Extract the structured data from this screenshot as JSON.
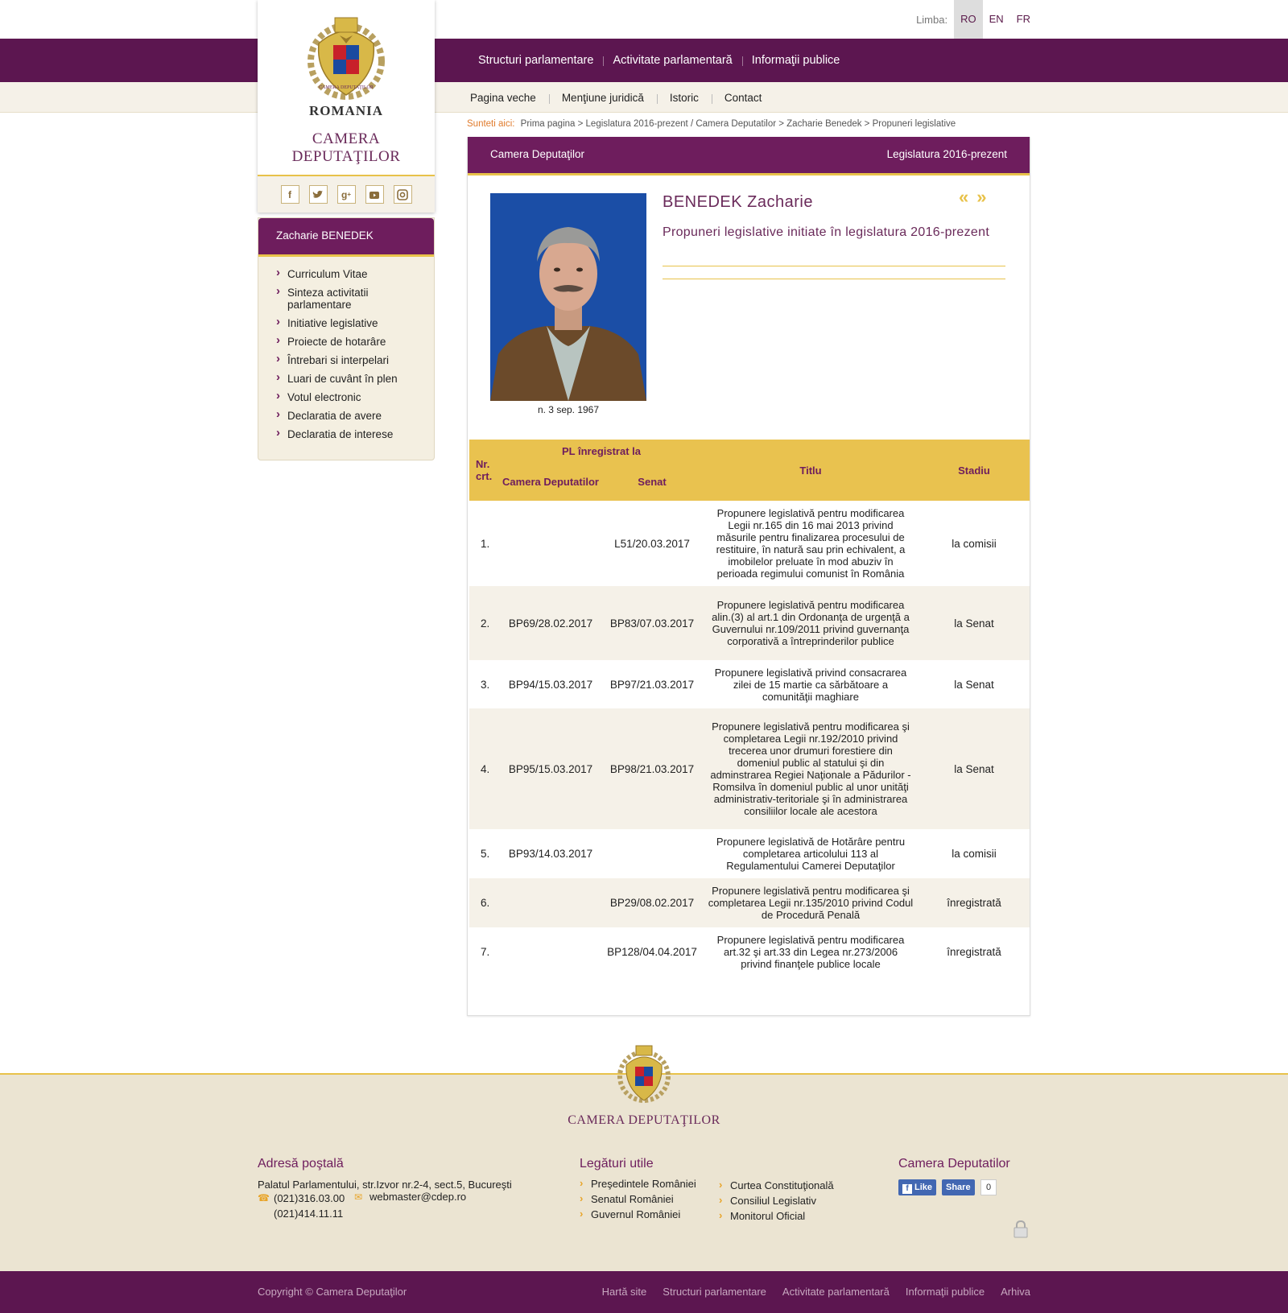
{
  "lang": {
    "label": "Limba:",
    "options": [
      "RO",
      "EN",
      "FR"
    ],
    "active": "RO"
  },
  "logo": {
    "country": "ROMANIA",
    "institution_line1": "CAMERA",
    "institution_line2": "DEPUTAŢILOR"
  },
  "social": [
    "facebook-icon",
    "twitter-icon",
    "google-plus-icon",
    "youtube-icon",
    "instagram-icon"
  ],
  "main_nav": [
    "Structuri parlamentare",
    "Activitate parlamentară",
    "Informaţii publice"
  ],
  "sub_nav": [
    "Pagina veche",
    "Menţiune juridică",
    "Istoric",
    "Contact"
  ],
  "breadcrumb": {
    "label": "Sunteti aici:",
    "path": "Prima pagina > Legislatura 2016-prezent / Camera Deputatilor > Zacharie Benedek > Propuneri legislative"
  },
  "sidebar": {
    "title": "Zacharie BENEDEK",
    "items": [
      "Curriculum Vitae",
      "Sinteza activitatii parlamentare",
      "Initiative legislative",
      "Proiecte de hotarâre",
      "Întrebari si interpelari",
      "Luari de cuvânt în plen",
      "Votul electronic",
      "Declaratia de avere",
      "Declaratia de interese"
    ]
  },
  "panel": {
    "left_title": "Camera Deputaţilor",
    "right_title": "Legislatura 2016-prezent",
    "name": "BENEDEK Zacharie",
    "birth": "n. 3 sep. 1967",
    "subtitle": "Propuneri legislative initiate în legislatura 2016-prezent",
    "prev_arrow": "«",
    "next_arrow": "»"
  },
  "table": {
    "headers": {
      "nr": "Nr. crt.",
      "pl": "PL înregistrat la",
      "cd": "Camera Deputatilor",
      "senat": "Senat",
      "titlu": "Titlu",
      "stadiu": "Stadiu"
    },
    "rows": [
      {
        "nr": "1.",
        "cd": "",
        "senat": "L51/20.03.2017",
        "titlu": "Propunere legislativă pentru modificarea Legii nr.165 din 16 mai 2013 privind măsurile pentru finalizarea procesului de restituire, în natură sau prin echivalent, a imobilelor preluate în mod abuziv în perioada regimului comunist în România",
        "stadiu": "la comisii"
      },
      {
        "nr": "2.",
        "cd": "BP69/28.02.2017",
        "senat": "BP83/07.03.2017",
        "titlu": "Propunere legislativă pentru modificarea alin.(3) al art.1 din Ordonanţa de urgenţă a Guvernului nr.109/2011 privind guvernanţa corporativă a întreprinderilor publice",
        "stadiu": "la Senat"
      },
      {
        "nr": "3.",
        "cd": "BP94/15.03.2017",
        "senat": "BP97/21.03.2017",
        "titlu": "Propunere legislativă privind consacrarea zilei de 15 martie ca sărbătoare a comunităţii maghiare",
        "stadiu": "la Senat"
      },
      {
        "nr": "4.",
        "cd": "BP95/15.03.2017",
        "senat": "BP98/21.03.2017",
        "titlu": "Propunere legislativă pentru modificarea şi completarea Legii nr.192/2010 privind trecerea unor drumuri forestiere din domeniul public al statului şi din adminstrarea Regiei Naţionale a Pădurilor - Romsilva în domeniul public al unor unităţi administrativ-teritoriale şi în administrarea consiliilor locale ale acestora",
        "stadiu": "la Senat"
      },
      {
        "nr": "5.",
        "cd": "BP93/14.03.2017",
        "senat": "",
        "titlu": "Propunere legislativă de Hotărâre pentru completarea articolului 113 al Regulamentului Camerei Deputaţilor",
        "stadiu": "la comisii"
      },
      {
        "nr": "6.",
        "cd": "",
        "senat": "BP29/08.02.2017",
        "titlu": "Propunere legislativă pentru modificarea şi completarea Legii nr.135/2010 privind Codul de Procedură Penală",
        "stadiu": "înregistrată"
      },
      {
        "nr": "7.",
        "cd": "",
        "senat": "BP128/04.04.2017",
        "titlu": "Propunere legislativă pentru modificarea art.32 şi art.33 din Legea nr.273/2006 privind finanţele publice locale",
        "stadiu": "înregistrată"
      }
    ]
  },
  "footer": {
    "title": "CAMERA DEPUTAŢILOR",
    "address_title": "Adresă poştală",
    "address": "Palatul Parlamentului, str.Izvor nr.2-4, sect.5, Bucureşti",
    "phone1": "(021)316.03.00",
    "phone2": "(021)414.11.11",
    "email": "webmaster@cdep.ro",
    "links_title": "Legături utile",
    "links_col1": [
      "Preşedintele României",
      "Senatul României",
      "Guvernul României"
    ],
    "links_col2": [
      "Curtea Constituţională",
      "Consiliul Legislativ",
      "Monitorul Oficial"
    ],
    "fb_title": "Camera Deputatilor",
    "fb_like": "Like",
    "fb_share": "Share",
    "fb_count": "0"
  },
  "bottom": {
    "copyright": "Copyright © Camera Deputaţilor",
    "links": [
      "Hartă site",
      "Structuri parlamentare",
      "Activitate parlamentară",
      "Informaţii publice",
      "Arhiva"
    ]
  },
  "colors": {
    "primary": "#5c1650",
    "accent": "#e8c24a",
    "panel_bg": "#f5f1e8"
  }
}
